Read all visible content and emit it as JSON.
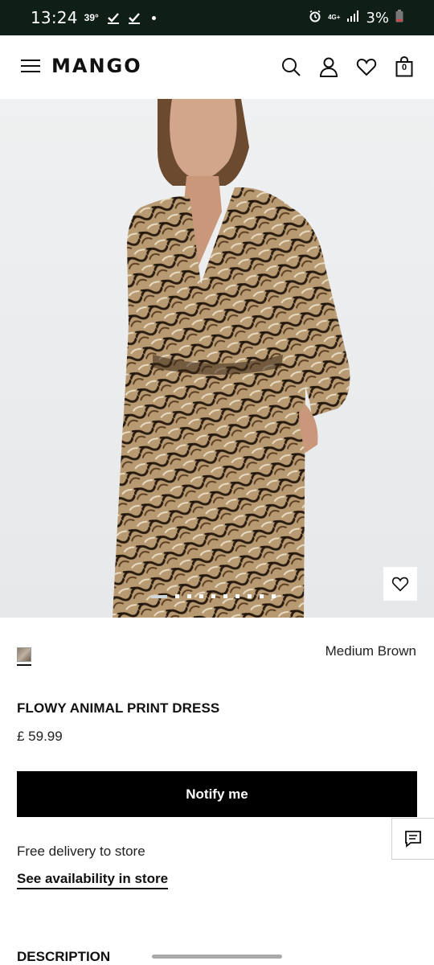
{
  "status_bar": {
    "time": "13:24",
    "temperature": "39°",
    "network_label": "4G+",
    "battery": "3%"
  },
  "header": {
    "logo": "MANGO",
    "cart_count": "0"
  },
  "gallery": {
    "image_count": 10,
    "active_index": 0
  },
  "product": {
    "color_name": "Medium Brown",
    "title": "FLOWY ANIMAL PRINT DRESS",
    "price": "£ 59.99",
    "notify_label": "Notify me",
    "delivery_text": "Free delivery to store",
    "availability_link": "See availability in store",
    "description_heading": "DESCRIPTION"
  },
  "colors": {
    "status_bar_bg": "#0f1f18",
    "button_bg": "#000000",
    "hero_bg": "#e6e8ea"
  }
}
